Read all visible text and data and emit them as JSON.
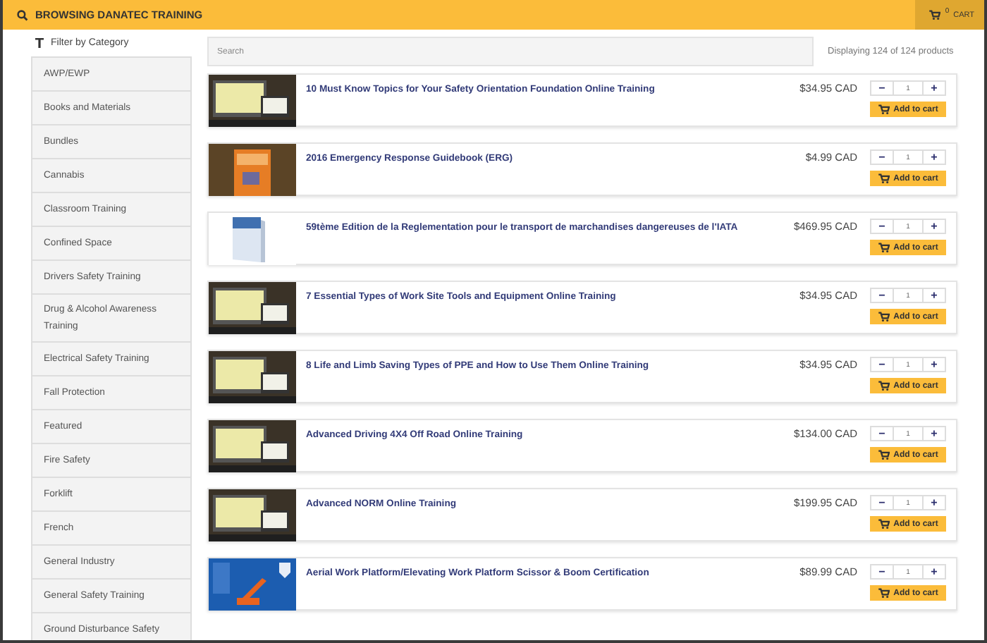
{
  "header": {
    "title": "BROWSING DANATEC TRAINING",
    "cart_count": "0",
    "cart_label": "CART"
  },
  "sidebar": {
    "heading": "Filter by Category",
    "items": [
      {
        "label": "AWP/EWP",
        "selected": false
      },
      {
        "label": "Books and Materials",
        "selected": false
      },
      {
        "label": "Bundles",
        "selected": false
      },
      {
        "label": "Cannabis",
        "selected": false
      },
      {
        "label": "Classroom Training",
        "selected": false
      },
      {
        "label": "Confined Space",
        "selected": false
      },
      {
        "label": "Drivers Safety Training",
        "selected": false
      },
      {
        "label": "Drug & Alcohol Awareness Training",
        "selected": false
      },
      {
        "label": "Electrical Safety Training",
        "selected": false
      },
      {
        "label": "Fall Protection",
        "selected": false
      },
      {
        "label": "Featured",
        "selected": false
      },
      {
        "label": "Fire Safety",
        "selected": false
      },
      {
        "label": "Forklift",
        "selected": false
      },
      {
        "label": "French",
        "selected": false
      },
      {
        "label": "General Industry",
        "selected": false
      },
      {
        "label": "General Safety Training",
        "selected": false
      },
      {
        "label": "Ground Disturbance Safety",
        "selected": false
      }
    ]
  },
  "search": {
    "placeholder": "Search"
  },
  "result_count": "Displaying 124 of 124 products",
  "products": [
    {
      "title": "10 Must Know Topics for Your Safety Orientation Foundation Online Training",
      "price": "$34.95 CAD",
      "quantity": "1",
      "minus": "−",
      "plus": "+",
      "button": "Add to cart",
      "kind": "screens"
    },
    {
      "title": "2016 Emergency Response Guidebook (ERG)",
      "price": "$4.99 CAD",
      "quantity": "1",
      "minus": "−",
      "plus": "+",
      "button": "Add to cart",
      "kind": "book"
    },
    {
      "title": "59tème Edition de la Reglementation pour le transport de marchandises dangereuses de l'IATA",
      "price": "$469.95 CAD",
      "quantity": "1",
      "minus": "−",
      "plus": "+",
      "button": "Add to cart",
      "kind": "manual"
    },
    {
      "title": "7 Essential Types of Work Site Tools and Equipment Online Training",
      "price": "$34.95 CAD",
      "quantity": "1",
      "minus": "−",
      "plus": "+",
      "button": "Add to cart",
      "kind": "screens"
    },
    {
      "title": "8 Life and Limb Saving Types of PPE and How to Use Them Online Training",
      "price": "$34.95 CAD",
      "quantity": "1",
      "minus": "−",
      "plus": "+",
      "button": "Add to cart",
      "kind": "screens"
    },
    {
      "title": "Advanced Driving 4X4 Off Road Online Training",
      "price": "$134.00 CAD",
      "quantity": "1",
      "minus": "−",
      "plus": "+",
      "button": "Add to cart",
      "kind": "screens"
    },
    {
      "title": "Advanced NORM Online Training",
      "price": "$199.95 CAD",
      "quantity": "1",
      "minus": "−",
      "plus": "+",
      "button": "Add to cart",
      "kind": "screens"
    },
    {
      "title": "Aerial Work Platform/Elevating Work Platform Scissor & Boom Certification",
      "price": "$89.99 CAD",
      "quantity": "1",
      "minus": "−",
      "plus": "+",
      "button": "Add to cart",
      "kind": "poster"
    }
  ]
}
